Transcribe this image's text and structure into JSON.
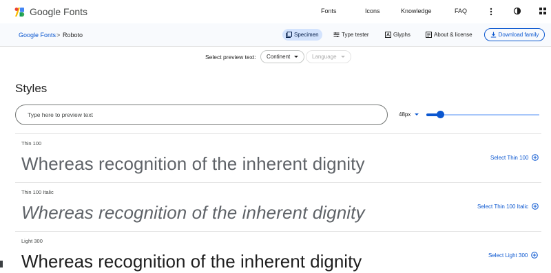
{
  "header": {
    "brand": "Google Fonts",
    "nav": [
      "Fonts",
      "Icons",
      "Knowledge",
      "FAQ"
    ],
    "icons": [
      "more-vert-icon",
      "theme-toggle-icon",
      "apps-grid-icon"
    ]
  },
  "breadcrumb": {
    "root": "Google Fonts",
    "separator": ">",
    "current": "Roboto"
  },
  "tabs": [
    {
      "label": "Specimen",
      "icon": "specimen-icon",
      "active": true
    },
    {
      "label": "Type tester",
      "icon": "type-tester-icon",
      "active": false
    },
    {
      "label": "Glyphs",
      "icon": "glyphs-icon",
      "active": false
    },
    {
      "label": "About & license",
      "icon": "about-icon",
      "active": false
    }
  ],
  "download_button": "Download family",
  "preview": {
    "label": "Select preview text:",
    "continent": "Continent",
    "language": "Language"
  },
  "styles": {
    "heading": "Styles",
    "input_placeholder": "Type here to preview text",
    "size_value": "48px",
    "slider_level": 0.12,
    "sample_text": "Whereas recognition of the inherent dignity",
    "rows": [
      {
        "name": "Thin 100",
        "select": "Select Thin 100"
      },
      {
        "name": "Thin 100 Italic",
        "select": "Select Thin 100 Italic"
      },
      {
        "name": "Light 300",
        "select": "Select Light 300"
      }
    ]
  },
  "colors": {
    "accent": "#0b57d0",
    "active_tab_bg": "#d3e3fd",
    "subbar_bg": "#f8fafd"
  }
}
